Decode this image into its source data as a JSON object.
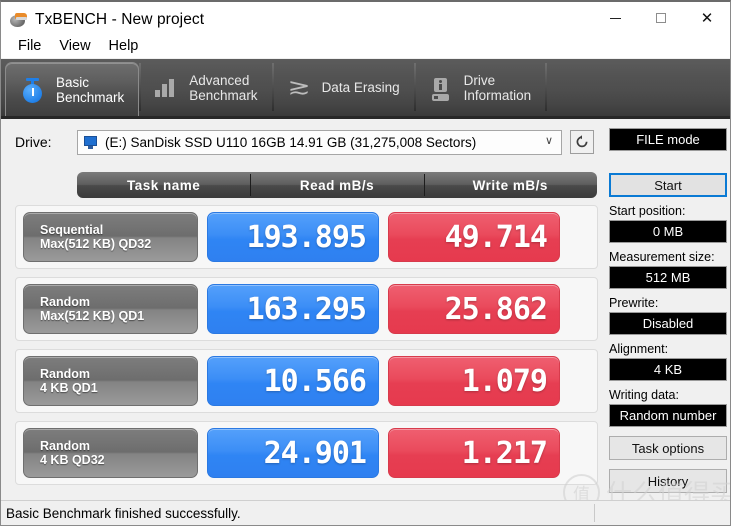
{
  "window": {
    "title": "TxBENCH - New project",
    "app_icon": "disk-drive-icon",
    "controls": {
      "minimize": "—",
      "maximize": "□",
      "close": "✕"
    }
  },
  "menu": {
    "items": [
      "File",
      "View",
      "Help"
    ]
  },
  "tabs": [
    {
      "label": "Basic\nBenchmark",
      "icon": "stopwatch-icon",
      "active": true
    },
    {
      "label": "Advanced\nBenchmark",
      "icon": "bar-chart-icon",
      "active": false
    },
    {
      "label": "Data Erasing",
      "icon": "eraser-zigzag-icon",
      "active": false
    },
    {
      "label": "Drive\nInformation",
      "icon": "drive-info-icon",
      "active": false
    }
  ],
  "drive": {
    "label": "Drive:",
    "selected": "(E:) SanDisk SSD U110 16GB  14.91 GB (31,275,008 Sectors)",
    "icon": "drive-small-icon",
    "caret": "∨",
    "refresh_icon": "refresh-icon"
  },
  "results": {
    "columns": [
      "Task name",
      "Read mB/s",
      "Write mB/s"
    ],
    "rows": [
      {
        "name_line1": "Sequential",
        "name_line2": "Max(512 KB) QD32",
        "read": "193.895",
        "write": "49.714"
      },
      {
        "name_line1": "Random",
        "name_line2": "Max(512 KB) QD1",
        "read": "163.295",
        "write": "25.862"
      },
      {
        "name_line1": "Random",
        "name_line2": "4 KB QD1",
        "read": "10.566",
        "write": "1.079"
      },
      {
        "name_line1": "Random",
        "name_line2": "4 KB QD32",
        "read": "24.901",
        "write": "1.217"
      }
    ]
  },
  "sidebar": {
    "mode_value": "FILE mode",
    "start_label": "Start",
    "start_position_label": "Start position:",
    "start_position_value": "0 MB",
    "measurement_size_label": "Measurement size:",
    "measurement_size_value": "512 MB",
    "prewrite_label": "Prewrite:",
    "prewrite_value": "Disabled",
    "alignment_label": "Alignment:",
    "alignment_value": "4 KB",
    "writing_data_label": "Writing data:",
    "writing_data_value": "Random number",
    "task_options_label": "Task options",
    "history_label": "History"
  },
  "statusbar": {
    "text": "Basic Benchmark finished successfully."
  },
  "watermark": {
    "mark": "值",
    "text": "什么值得买"
  },
  "colors": {
    "read_blue": "#3c8ef6",
    "write_red": "#ea4a5c",
    "accent_blue": "#0a7ad4",
    "tab_bar": "#4e4e4e"
  }
}
